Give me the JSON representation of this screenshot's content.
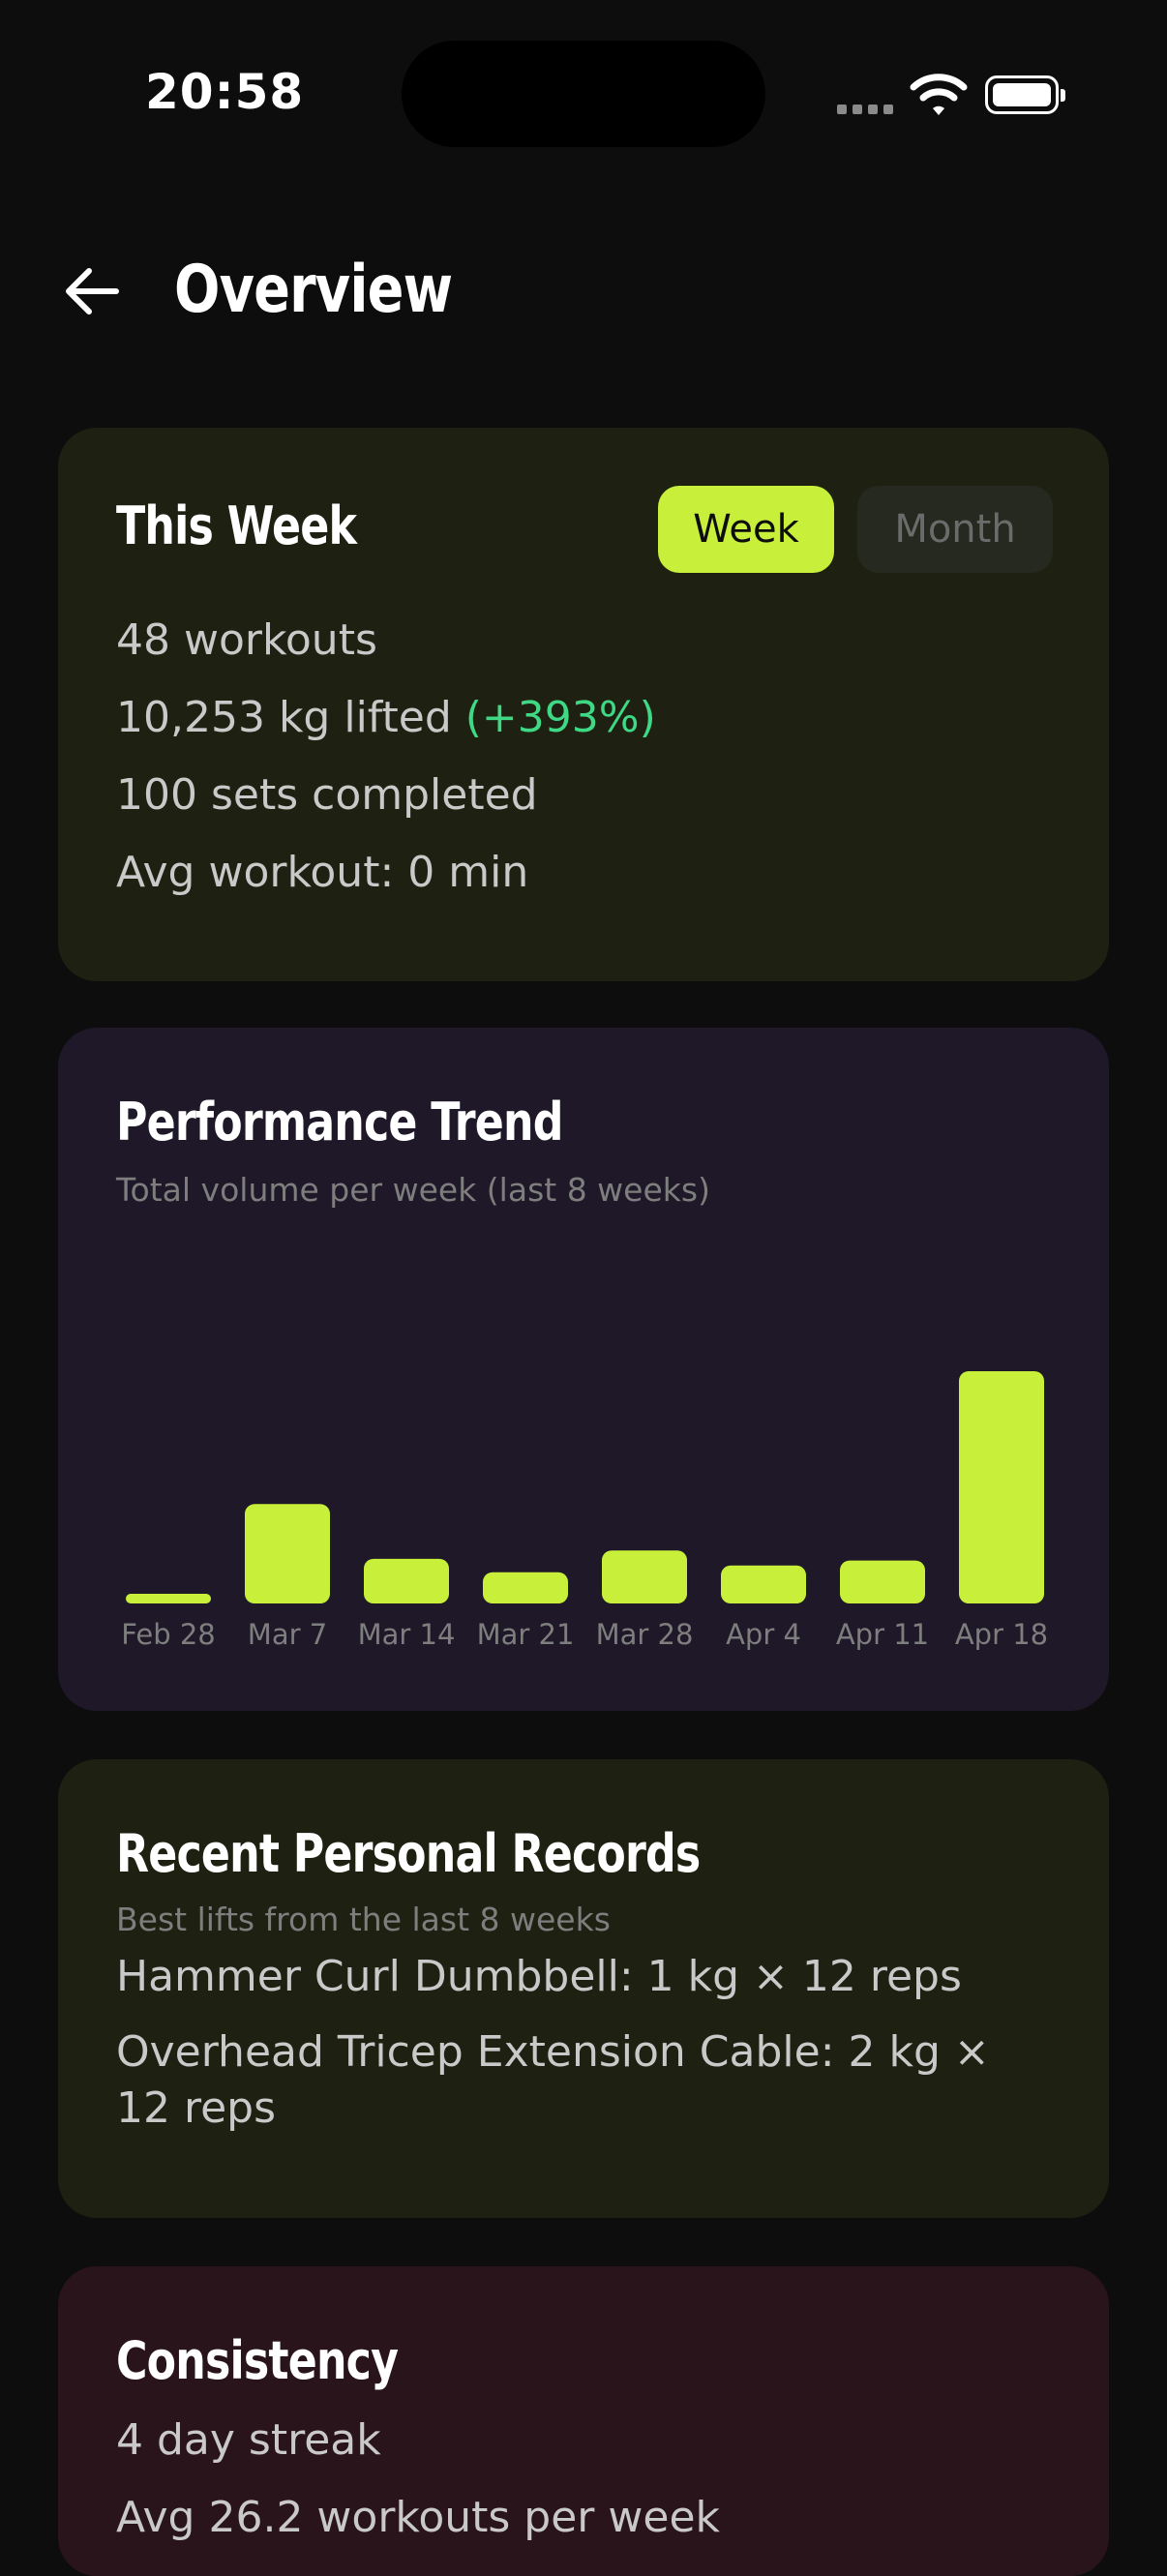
{
  "status_bar": {
    "time": "20:58"
  },
  "header": {
    "title": "Overview"
  },
  "this_week": {
    "title": "This Week",
    "toggle": {
      "week_label": "Week",
      "month_label": "Month",
      "selected": "Week"
    },
    "workouts": "48 workouts",
    "lifted": "10,253 kg lifted",
    "lifted_change": "(+393%)",
    "sets": "100 sets completed",
    "avg_workout": "Avg workout: 0 min"
  },
  "performance": {
    "title": "Performance Trend",
    "subtitle": "Total volume per week (last 8 weeks)"
  },
  "chart_data": {
    "type": "bar",
    "categories": [
      "Feb 28",
      "Mar 7",
      "Mar 14",
      "Mar 21",
      "Mar 28",
      "Apr 4",
      "Apr 11",
      "Apr 18"
    ],
    "values": [
      75,
      890,
      400,
      280,
      475,
      340,
      385,
      2080
    ],
    "ylim": [
      0,
      2080
    ],
    "grid": false,
    "colors": {
      "bar": "#c8f03a",
      "label": "#7e7e7e"
    }
  },
  "records": {
    "title": "Recent Personal Records",
    "subtitle": "Best lifts from the last 8 weeks",
    "items": [
      "Hammer Curl Dumbbell: 1 kg × 12 reps",
      "Overhead Tricep Extension Cable: 2 kg × 12 reps"
    ]
  },
  "consistency": {
    "title": "Consistency",
    "streak": "4 day streak",
    "avg": "Avg 26.2 workouts per week"
  },
  "colors": {
    "background": "#0d0d0d",
    "accent": "#c8f03a",
    "positive": "#3fd884",
    "card_green": "#1e2111",
    "card_purple": "#1e1828",
    "card_red": "#2a141c"
  }
}
